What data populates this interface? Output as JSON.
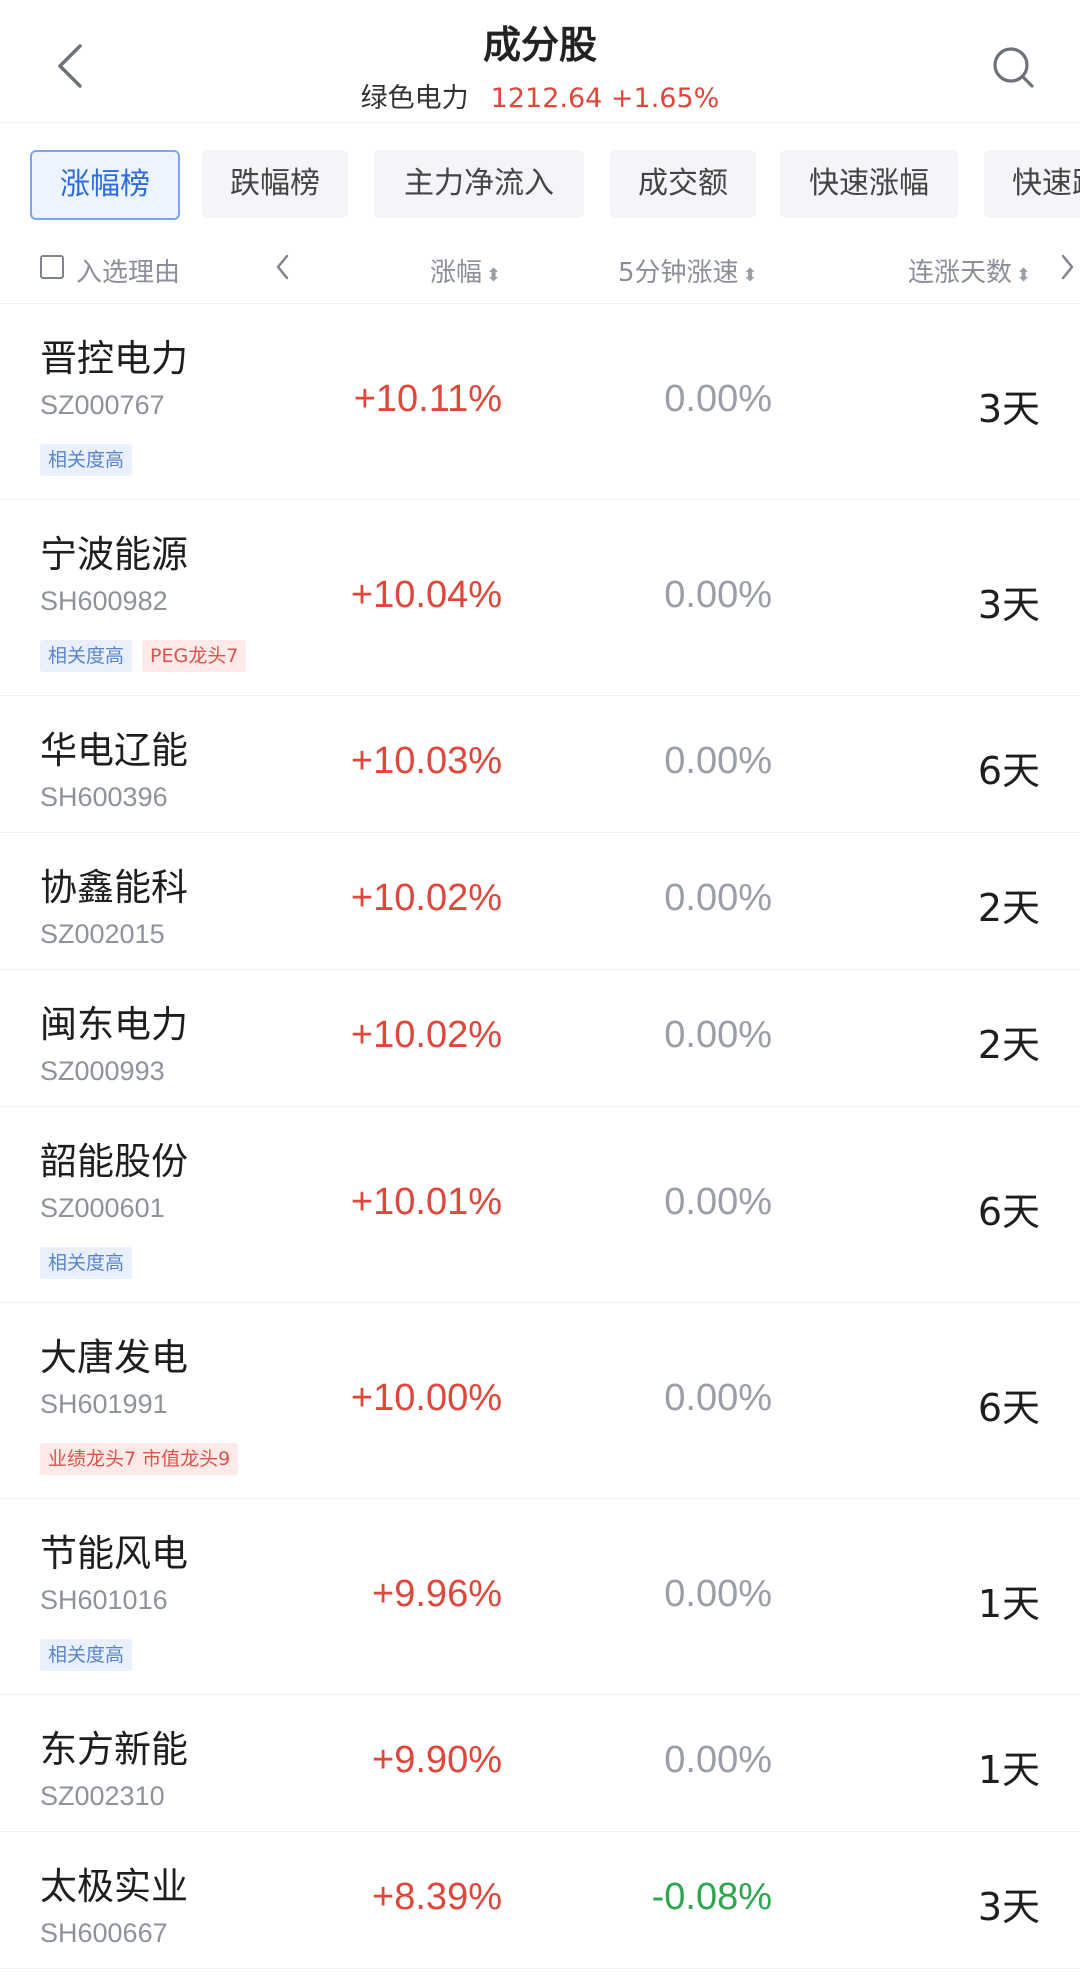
{
  "header": {
    "title": "成分股",
    "index_name": "绿色电力",
    "index_price": "1212.64",
    "index_change": "+1.65%"
  },
  "tabs": [
    {
      "label": "涨幅榜",
      "active": true
    },
    {
      "label": "跌幅榜",
      "active": false
    },
    {
      "label": "主力净流入",
      "active": false
    },
    {
      "label": "成交额",
      "active": false
    },
    {
      "label": "快速涨幅",
      "active": false
    },
    {
      "label": "快速跌",
      "active": false
    }
  ],
  "columns": {
    "reason": "入选理由",
    "change": "涨幅",
    "speed": "5分钟涨速",
    "days": "连涨天数",
    "sort_glyph": "⬍"
  },
  "colors": {
    "up": "#e0463a",
    "down": "#2fa64d",
    "flat": "#9a9ea6",
    "accent": "#2d6cdf"
  },
  "rows": [
    {
      "name": "晋控电力",
      "code": "SZ000767",
      "change": "+10.11%",
      "speed": "0.00%",
      "days": "3天",
      "tags": [
        {
          "text": "相关度高",
          "color": "blue"
        }
      ]
    },
    {
      "name": "宁波能源",
      "code": "SH600982",
      "change": "+10.04%",
      "speed": "0.00%",
      "days": "3天",
      "tags": [
        {
          "text": "相关度高",
          "color": "blue"
        },
        {
          "text": "PEG龙头7",
          "color": "red"
        }
      ]
    },
    {
      "name": "华电辽能",
      "code": "SH600396",
      "change": "+10.03%",
      "speed": "0.00%",
      "days": "6天",
      "tags": []
    },
    {
      "name": "协鑫能科",
      "code": "SZ002015",
      "change": "+10.02%",
      "speed": "0.00%",
      "days": "2天",
      "tags": []
    },
    {
      "name": "闽东电力",
      "code": "SZ000993",
      "change": "+10.02%",
      "speed": "0.00%",
      "days": "2天",
      "tags": []
    },
    {
      "name": "韶能股份",
      "code": "SZ000601",
      "change": "+10.01%",
      "speed": "0.00%",
      "days": "6天",
      "tags": [
        {
          "text": "相关度高",
          "color": "blue"
        }
      ]
    },
    {
      "name": "大唐发电",
      "code": "SH601991",
      "change": "+10.00%",
      "speed": "0.00%",
      "days": "6天",
      "tags": [
        {
          "text": "业绩龙头7 市值龙头9",
          "color": "red"
        }
      ]
    },
    {
      "name": "节能风电",
      "code": "SH601016",
      "change": "+9.96%",
      "speed": "0.00%",
      "days": "1天",
      "tags": [
        {
          "text": "相关度高",
          "color": "blue"
        }
      ]
    },
    {
      "name": "东方新能",
      "code": "SZ002310",
      "change": "+9.90%",
      "speed": "0.00%",
      "days": "1天",
      "tags": []
    },
    {
      "name": "太极实业",
      "code": "SH600667",
      "change": "+8.39%",
      "speed": "-0.08%",
      "days": "3天",
      "tags": []
    }
  ]
}
